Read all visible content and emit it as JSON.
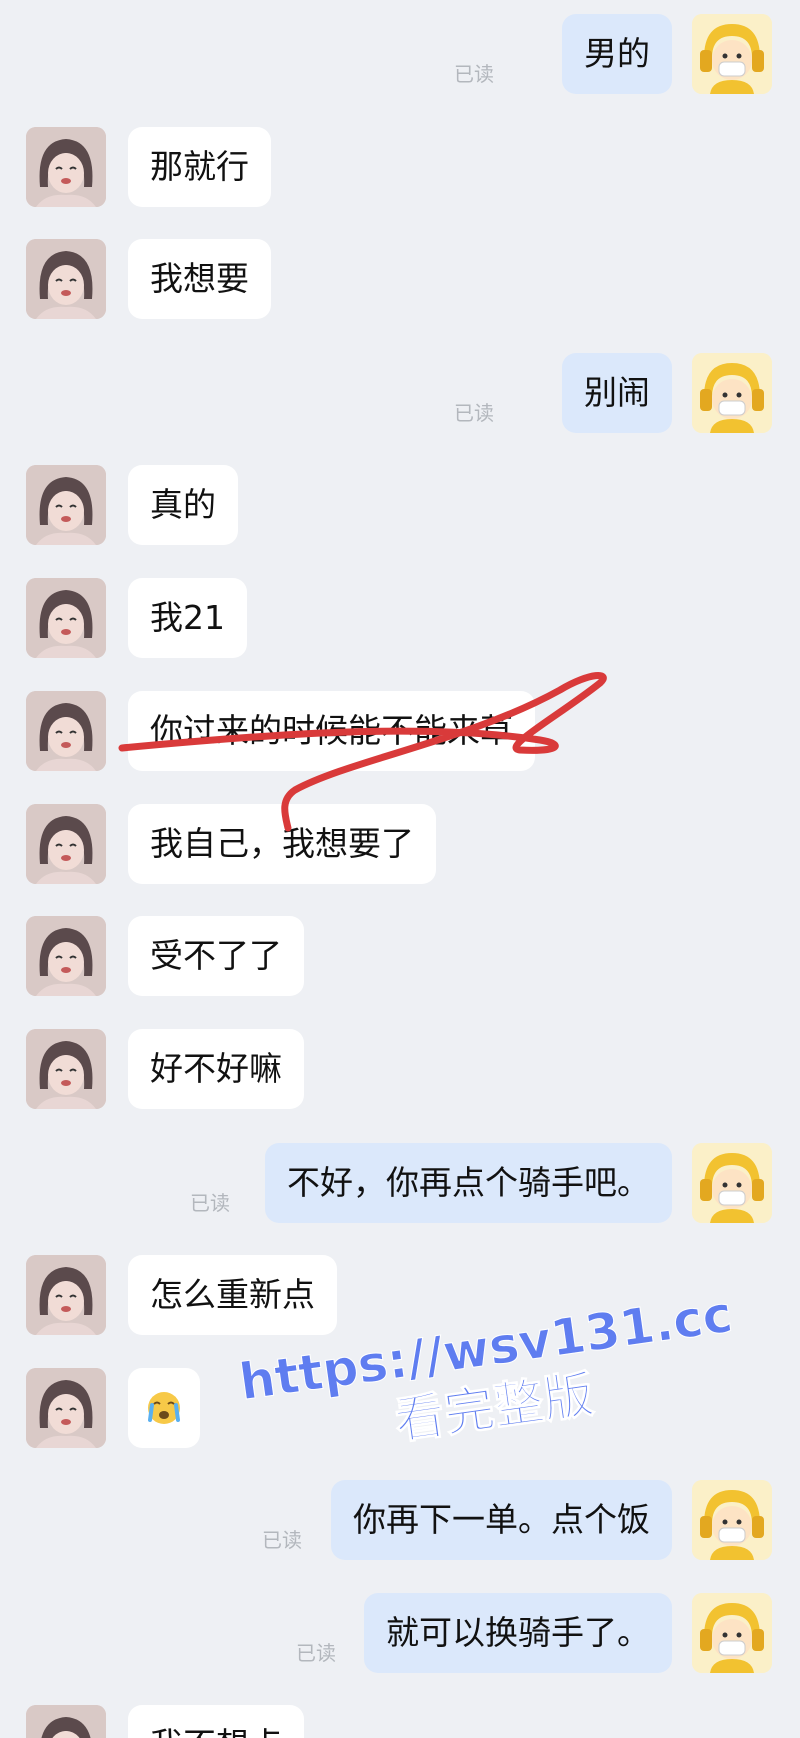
{
  "read_label": "已读",
  "messages": [
    {
      "side": "right",
      "text": "男的",
      "read": true
    },
    {
      "side": "left",
      "text": "那就行"
    },
    {
      "side": "left",
      "text": "我想要"
    },
    {
      "side": "right",
      "text": "别闹",
      "read": true
    },
    {
      "side": "left",
      "text": "真的"
    },
    {
      "side": "left",
      "text": "我21"
    },
    {
      "side": "left",
      "text": "你过来的时候能不能来草",
      "struck": true
    },
    {
      "side": "left",
      "text": "我自己，我想要了"
    },
    {
      "side": "left",
      "text": "受不了了"
    },
    {
      "side": "left",
      "text": "好不好嘛"
    },
    {
      "side": "right",
      "text": "不好，你再点个骑手吧。",
      "read": true
    },
    {
      "side": "left",
      "text": "怎么重新点"
    },
    {
      "side": "left",
      "text": "",
      "emoji": "crying-face-emoji"
    },
    {
      "side": "right",
      "text": "你再下一单。点个饭",
      "read": true
    },
    {
      "side": "right",
      "text": "就可以换骑手了。",
      "read": true
    },
    {
      "side": "left",
      "text": "我不想点"
    }
  ],
  "watermark": {
    "line1": "https://wsv131.cc",
    "line2": "看完整版"
  },
  "colors": {
    "background": "#eef0f4",
    "bubble_left": "#ffffff",
    "bubble_right": "#dbe8fb",
    "scribble": "#d93a3a",
    "watermark": "#5f7df0"
  }
}
